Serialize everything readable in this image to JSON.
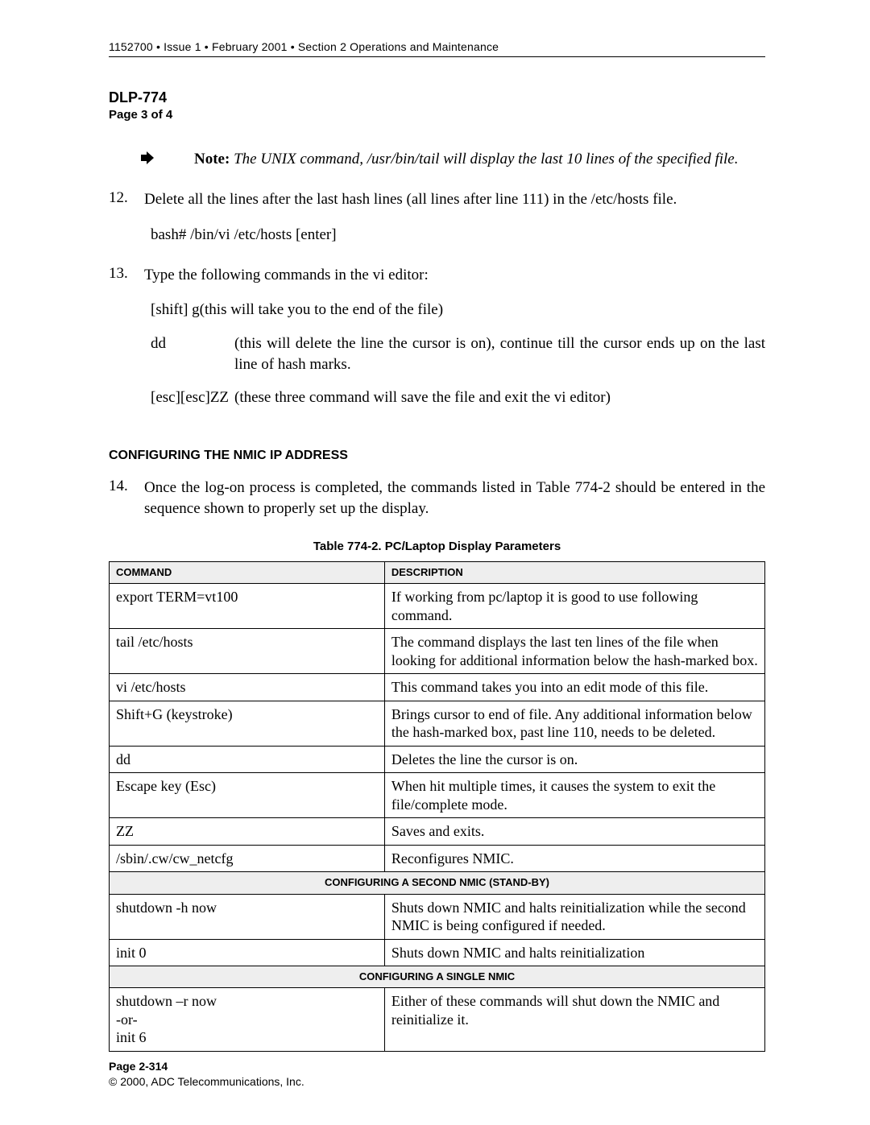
{
  "header": "1152700 • Issue 1 • February 2001 • Section 2 Operations and Maintenance",
  "dlp": "DLP-774",
  "pageOf": "Page 3 of 4",
  "note": {
    "label": "Note:",
    "text": "The UNIX command, /usr/bin/tail will display the last 10 lines of the specified file."
  },
  "step12": {
    "num": "12.",
    "text": "Delete all the lines after the last hash lines (all lines after line 111) in the /etc/hosts file.",
    "cmd": "bash# /bin/vi /etc/hosts [enter]"
  },
  "step13": {
    "num": "13.",
    "text": "Type the following commands in the vi editor:",
    "row1": "[shift] g(this will take you to the end of the file)",
    "row2cmd": "dd",
    "row2desc": "(this will delete the line the cursor is on), continue till the cursor ends up on the last line of hash marks.",
    "row3cmd": "[esc][esc]ZZ",
    "row3desc": "(these three command will save the file and exit the vi editor)"
  },
  "sectionHeading": "CONFIGURING THE NMIC IP ADDRESS",
  "step14": {
    "num": "14.",
    "text": "Once the log-on process is completed, the commands listed in Table 774-2 should be entered in the sequence shown to properly set up the display."
  },
  "tableCaption": "Table 774-2. PC/Laptop Display Parameters",
  "th": {
    "c1": "COMMAND",
    "c2": "DESCRIPTION"
  },
  "rows": {
    "r1c1": "export TERM=vt100",
    "r1c2": "If working from pc/laptop it is good to use following command.",
    "r2c1": "tail /etc/hosts",
    "r2c2": "The command displays the last ten lines of the file when looking for additional information below the hash-marked box.",
    "r3c1": "vi /etc/hosts",
    "r3c2": "This command takes you into an edit mode of this file.",
    "r4c1": "Shift+G (keystroke)",
    "r4c2": "Brings cursor to end of file. Any additional information below the hash-marked box, past line 110, needs to be deleted.",
    "r5c1": "dd",
    "r5c2": "Deletes the line the cursor is on.",
    "r6c1": "Escape key (Esc)",
    "r6c2": "When hit multiple times, it causes the system to exit the file/complete mode.",
    "r7c1": "ZZ",
    "r7c2": "Saves and exits.",
    "r8c1": "/sbin/.cw/cw_netcfg",
    "r8c2": "Reconfigures NMIC.",
    "sub1": "CONFIGURING A SECOND NMIC (STAND-BY)",
    "r9c1": "shutdown -h now",
    "r9c2": "Shuts down NMIC and halts reinitialization while the second NMIC is being configured if needed.",
    "r10c1": "init 0",
    "r10c2": "Shuts down NMIC and halts reinitialization",
    "sub2": "CONFIGURING A SINGLE NMIC",
    "r11c1": "shutdown –r now\n-or-\ninit 6",
    "r11c2": "Either of these commands will shut down the NMIC and reinitialize it."
  },
  "footer": {
    "page": "Page 2-314",
    "copyright": "© 2000, ADC Telecommunications, Inc."
  }
}
